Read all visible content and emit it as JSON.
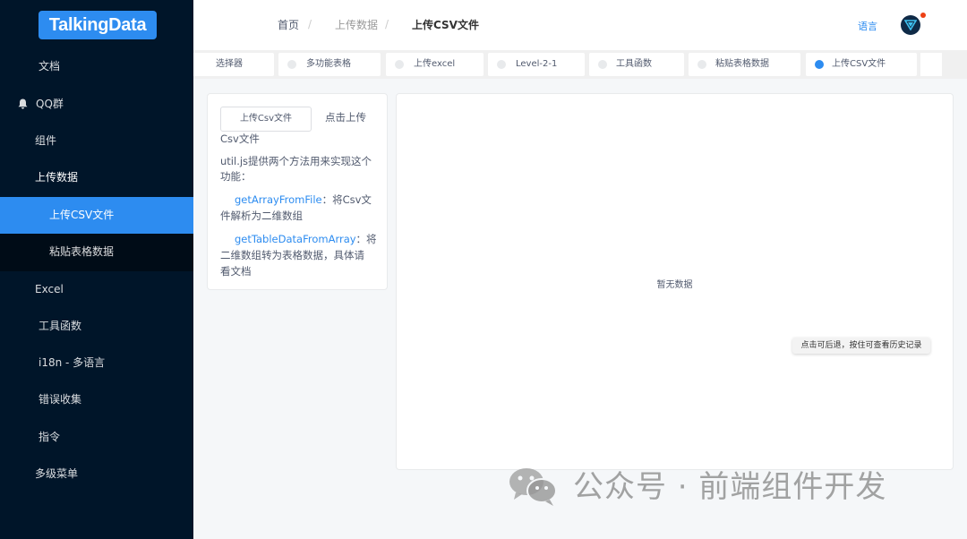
{
  "logo": {
    "text": "TalkingData"
  },
  "sidebar": {
    "items": [
      {
        "label": "文档"
      },
      {
        "label": "QQ群"
      },
      {
        "label": "组件"
      },
      {
        "label": "上传数据"
      },
      {
        "label": "上传CSV文件"
      },
      {
        "label": "粘贴表格数据"
      },
      {
        "label": "Excel"
      },
      {
        "label": "工具函数"
      },
      {
        "label": "i18n - 多语言"
      },
      {
        "label": "错误收集"
      },
      {
        "label": "指令"
      },
      {
        "label": "多级菜单"
      }
    ]
  },
  "header": {
    "breadcrumb": [
      "首页",
      "上传数据",
      "上传CSV文件"
    ],
    "separator": "/",
    "language": "语言"
  },
  "tags": [
    {
      "label": "选择器"
    },
    {
      "label": "多功能表格"
    },
    {
      "label": "上传excel"
    },
    {
      "label": "Level-2-1"
    },
    {
      "label": "工具函数"
    },
    {
      "label": "粘贴表格数据"
    },
    {
      "label": "上传CSV文件",
      "active": true
    }
  ],
  "left_card": {
    "upload_button": "上传Csv文件",
    "click_hint_1": "点击上传",
    "click_hint_2": "Csv文件",
    "desc_1": "util.js提供两个方法用来实现这个",
    "desc_2": "功能：",
    "method1_name": "getArrayFromFile",
    "method1_desc_a": "：将Csv文",
    "method1_desc_b": "件解析为二维数组",
    "method2_name": "getTableDataFromArray",
    "method2_desc_a": "：将",
    "method2_desc_b": "二维数组转为表格数据，具体请",
    "method2_desc_c": "看文档"
  },
  "right_card": {
    "no_data": "暂无数据"
  },
  "tooltip": "点击可后退，按住可查看历史记录",
  "watermark": "公众号 · 前端组件开发",
  "colors": {
    "primary": "#2d8cf0",
    "sidebar": "#001529"
  }
}
